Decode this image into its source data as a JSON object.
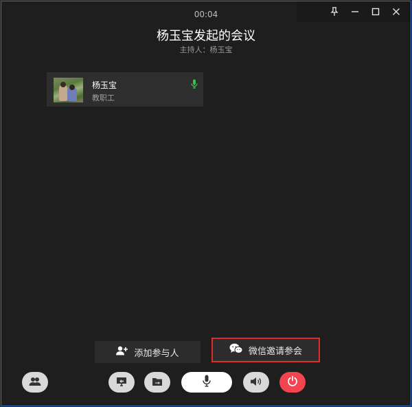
{
  "window": {
    "controls": [
      "pin-icon",
      "minimize-icon",
      "maximize-icon",
      "close-icon"
    ]
  },
  "meeting": {
    "timer": "00:04",
    "title": "杨玉宝发起的会议",
    "host": "主持人：杨玉宝"
  },
  "participant": {
    "name": "杨玉宝",
    "role": "教职工",
    "mic_color": "#3ec04a"
  },
  "actions": {
    "add_label": "添加参与人",
    "wechat_label": "微信邀请参会"
  },
  "toolbar": {
    "items": [
      "participants-icon",
      "screen-share-icon",
      "file-share-icon",
      "microphone-icon",
      "speaker-icon",
      "hang-up-icon"
    ]
  },
  "colors": {
    "highlight_border": "#e22b2b",
    "end_call": "#f2454f"
  }
}
